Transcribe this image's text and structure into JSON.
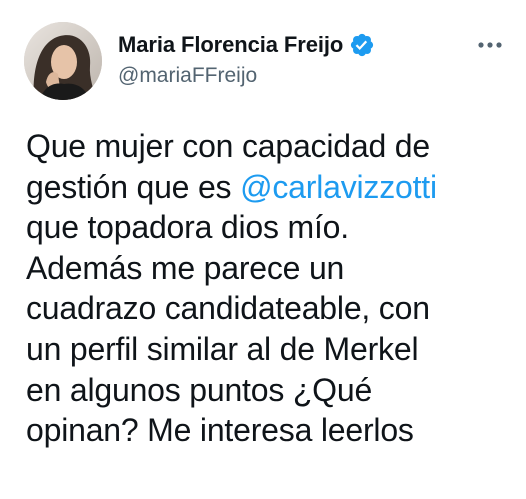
{
  "author": {
    "display_name": "Maria Florencia Freijo",
    "handle": "@mariaFFreijo",
    "verified_icon": "verified-badge-icon",
    "avatar_icon": "profile-photo"
  },
  "more_icon": "more-options-icon",
  "tweet": {
    "lines": [
      [
        "Que mujer con capacidad de"
      ],
      [
        "gestión que es ",
        "@carlavizzotti"
      ],
      [
        "que topadora dios mío."
      ],
      [
        "Además me parece un"
      ],
      [
        "cuadrazo candidateable, con"
      ],
      [
        "un perfil similar al de Merkel"
      ],
      [
        "en algunos puntos ¿Qué"
      ],
      [
        "opinan? Me interesa leerlos"
      ]
    ],
    "mention": "@carlavizzotti"
  },
  "colors": {
    "text": "#0f1419",
    "secondary": "#536471",
    "accent": "#1d9bf0"
  }
}
